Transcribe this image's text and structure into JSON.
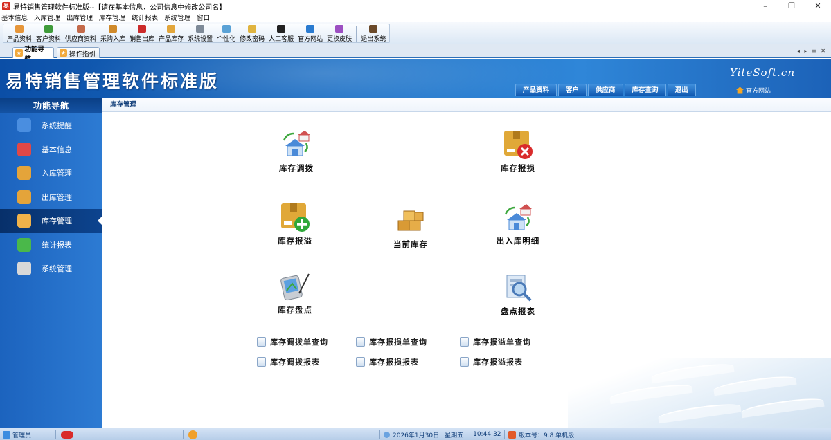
{
  "window": {
    "title": "易特销售管理软件标准版--【请在基本信息，公司信息中修改公司名】",
    "controls": [
      "–",
      "❐",
      "✕"
    ]
  },
  "menu": [
    "基本信息",
    "入库管理",
    "出库管理",
    "库存管理",
    "统计报表",
    "系统管理",
    "窗口"
  ],
  "toolbar": [
    {
      "label": "产品资料",
      "color": "#e6963a"
    },
    {
      "label": "客户资料",
      "color": "#3f9b3a"
    },
    {
      "label": "供应商资料",
      "color": "#c46a4a"
    },
    {
      "label": "采购入库",
      "color": "#d08a2a"
    },
    {
      "label": "销售出库",
      "color": "#cc2b2b"
    },
    {
      "label": "产品库存",
      "color": "#e2a63b"
    },
    {
      "label": "系统设置",
      "color": "#7e8a98"
    },
    {
      "label": "个性化",
      "color": "#5aa2d6"
    },
    {
      "label": "修改密码",
      "color": "#e0b440"
    },
    {
      "label": "人工客服",
      "color": "#222222"
    },
    {
      "label": "官方网站",
      "color": "#2a7bd0"
    },
    {
      "label": "更换皮肤",
      "color": "#9c4fc2"
    },
    {
      "label": "退出系统",
      "color": "#6b4a2a"
    }
  ],
  "tabs": [
    {
      "label": "功能导航",
      "active": true
    },
    {
      "label": "操作指引",
      "active": false
    }
  ],
  "tab_controls": "◂ ▸ ≡ ✕",
  "banner": {
    "title": "易特销售管理软件标准版",
    "brand": "YiteSoft.cn",
    "quick_nav": [
      "产品资料",
      "客户",
      "供应商",
      "库存查询",
      "退出"
    ],
    "official_site": "官方网站"
  },
  "sidebar": {
    "header": "功能导航",
    "items": [
      {
        "label": "系统提醒",
        "color": "#4a8ee0",
        "active": false
      },
      {
        "label": "基本信息",
        "color": "#e04848",
        "active": false
      },
      {
        "label": "入库管理",
        "color": "#e4a43a",
        "active": false
      },
      {
        "label": "出库管理",
        "color": "#e4a43a",
        "active": false
      },
      {
        "label": "库存管理",
        "color": "#f0b24a",
        "active": true
      },
      {
        "label": "统计报表",
        "color": "#4ab84a",
        "active": false
      },
      {
        "label": "系统管理",
        "color": "#d8d8d8",
        "active": false
      }
    ]
  },
  "breadcrumb": "库存管理",
  "functions": [
    {
      "label": "库存调拨",
      "icon": "warehouse-transfer"
    },
    {
      "label": "库存报损",
      "icon": "box-remove"
    },
    {
      "label": "库存报溢",
      "icon": "box-add"
    },
    {
      "label": "当前库存",
      "icon": "boxes-stack"
    },
    {
      "label": "出入库明细",
      "icon": "warehouse-detail"
    },
    {
      "label": "库存盘点",
      "icon": "pda-check"
    },
    {
      "label": "盘点报表",
      "icon": "report-search"
    }
  ],
  "query_links": [
    "库存调拨单查询",
    "库存报损单查询",
    "库存报溢单查询",
    "库存调拨报表",
    "库存报损报表",
    "库存报溢报表"
  ],
  "status": {
    "user": "管理员",
    "date": "2026年1月30日",
    "weekday": "星期五",
    "time": "10:44:32",
    "version": "版本号：9.8 单机版"
  }
}
